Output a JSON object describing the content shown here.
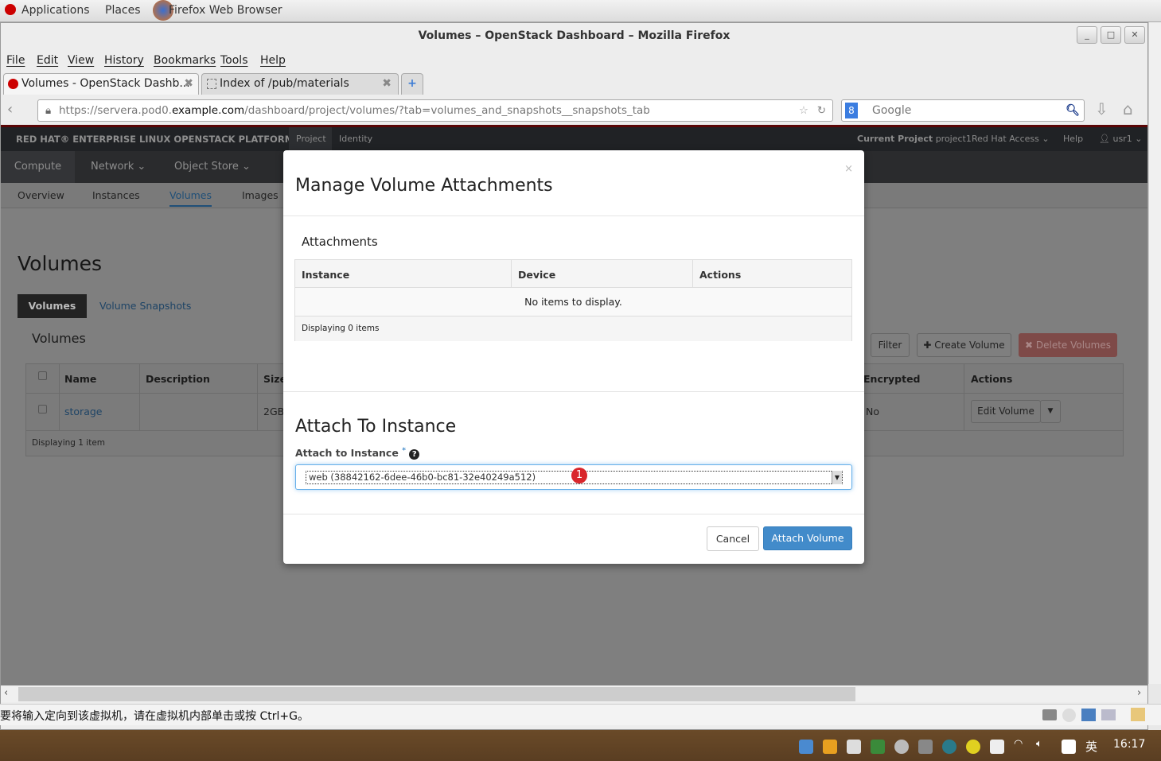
{
  "desktop": {
    "applications": "Applications",
    "places": "Places",
    "app_name": "Firefox Web Browser",
    "clock": "16:17",
    "ime": "英"
  },
  "window": {
    "title": "Volumes – OpenStack Dashboard – Mozilla Firefox"
  },
  "menu": [
    "File",
    "Edit",
    "View",
    "History",
    "Bookmarks",
    "Tools",
    "Help"
  ],
  "tabs": [
    {
      "label": "Volumes - OpenStack Dashb..."
    },
    {
      "label": "Index of /pub/materials"
    }
  ],
  "url": {
    "prefix": "https://servera.pod0.",
    "domain": "example.com",
    "path": "/dashboard/project/volumes/?tab=volumes_and_snapshots__snapshots_tab"
  },
  "search": {
    "placeholder": "Google"
  },
  "header": {
    "brand": "RED HAT® ENTERPRISE LINUX OPENSTACK PLATFORM",
    "project_tab": "Project",
    "identity_tab": "Identity",
    "current_project_label": "Current Project",
    "current_project": "project1",
    "redhat_access": "Red Hat Access",
    "help": "Help",
    "user": "usr1"
  },
  "nav": {
    "compute": "Compute",
    "network": "Network",
    "object_store": "Object Store"
  },
  "subnav": [
    "Overview",
    "Instances",
    "Volumes",
    "Images"
  ],
  "main": {
    "title": "Volumes",
    "tab_volumes": "Volumes",
    "tab_snapshots": "Volume Snapshots",
    "section": "Volumes",
    "filter": "Filter",
    "create": "Create Volume",
    "delete": "Delete Volumes",
    "columns": {
      "name": "Name",
      "description": "Description",
      "size": "Size",
      "encrypted": "Encrypted",
      "actions": "Actions"
    },
    "row": {
      "name": "storage",
      "size": "2GB",
      "encrypted": "No",
      "action": "Edit Volume"
    },
    "footer": "Displaying 1 item"
  },
  "modal": {
    "title": "Manage Volume Attachments",
    "attachments": "Attachments",
    "columns": [
      "Instance",
      "Device",
      "Actions"
    ],
    "empty": "No items to display.",
    "footer": "Displaying 0 items",
    "attach_title": "Attach To Instance",
    "attach_label": "Attach to Instance",
    "required": "*",
    "selected": "web (38842162-6dee-46b0-bc81-32e40249a512)",
    "badge": "1",
    "cancel": "Cancel",
    "submit": "Attach Volume"
  },
  "status_bar": {
    "message": "要将输入定向到该虚拟机，请在虚拟机内部单击或按 Ctrl+G。"
  },
  "colors": {
    "primary": "#428bca",
    "danger": "#d9534f",
    "header": "#202225",
    "badge": "#d9262b"
  }
}
